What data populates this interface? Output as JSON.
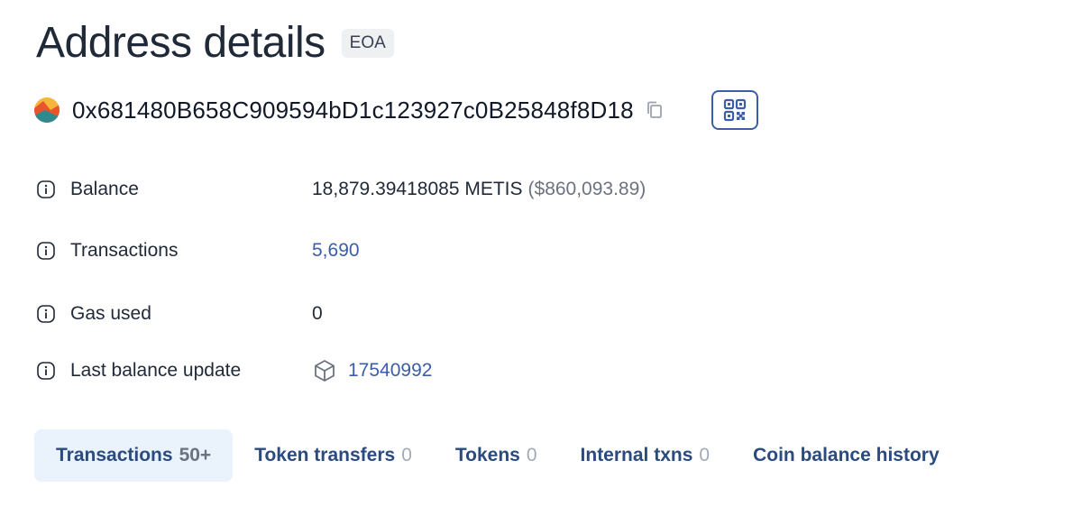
{
  "header": {
    "title": "Address details",
    "badge": "EOA"
  },
  "address": {
    "value": "0x681480B658C909594bD1c123927c0B25848f8D18",
    "avatar_icon": "identicon-avatar",
    "copy_icon": "copy-icon",
    "qr_icon": "qr-code-icon"
  },
  "details": {
    "balance": {
      "label": "Balance",
      "amount": "18,879.39418085 METIS",
      "usd": "($860,093.89)"
    },
    "transactions": {
      "label": "Transactions",
      "value": "5,690"
    },
    "gas_used": {
      "label": "Gas used",
      "value": "0"
    },
    "last_balance_update": {
      "label": "Last balance update",
      "value": "17540992",
      "icon": "block-cube-icon"
    }
  },
  "tabs": [
    {
      "label": "Transactions",
      "count": "50+",
      "active": true
    },
    {
      "label": "Token transfers",
      "count": "0",
      "active": false
    },
    {
      "label": "Tokens",
      "count": "0",
      "active": false
    },
    {
      "label": "Internal txns",
      "count": "0",
      "active": false
    },
    {
      "label": "Coin balance history",
      "count": "",
      "active": false
    }
  ],
  "colors": {
    "accent": "#3b5ea6",
    "tab_text": "#2b4a7e",
    "active_tab_bg": "#eaf3fb",
    "muted": "#6b7280"
  }
}
